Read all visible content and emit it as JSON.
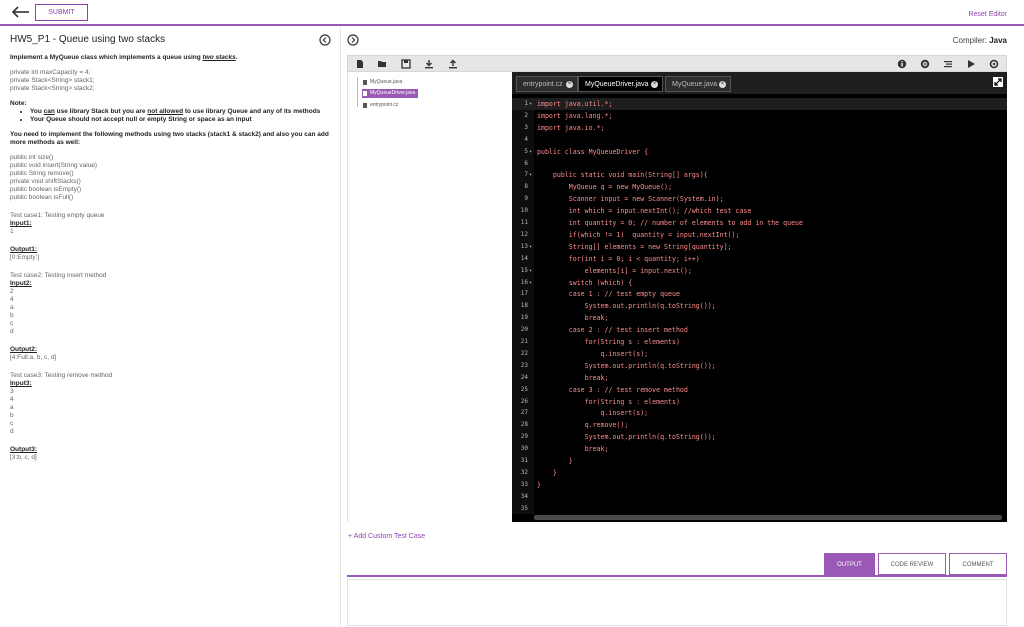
{
  "header": {
    "submit_label": "SUBMIT",
    "reset_label": "Reset Editor"
  },
  "problem": {
    "title": "HW5_P1 - Queue using two stacks",
    "intro_prefix": "Implement a MyQueue class which implements a queue using ",
    "intro_emph": "two stacks",
    "intro_suffix": ".",
    "fields": [
      "private int maxCapacity = 4;",
      "private Stack<String> stack1;",
      "private Stack<String> stack2;"
    ],
    "note_label": "Note:",
    "note1_a": "You ",
    "note1_can": "can",
    "note1_b": " use library Stack but you are ",
    "note1_not": "not allowed",
    "note1_c": " to use library Queue and any of its methods",
    "note2": "Your Queue should not accept null or empty String or space as an input",
    "task": "You need to implement the following methods using two stacks (stack1 & stack2) and also you can add more methods as well:",
    "methods": [
      "public int size()",
      "public void insert(String value)",
      "public String remove()",
      "private void shiftStacks()",
      "public boolean isEmpty()",
      "public boolean isFull()"
    ],
    "cases": [
      {
        "title": "Test case1: Testing empty queue",
        "input_label": "Input1:",
        "input": [
          "1"
        ],
        "output_label": "Output1:",
        "output": "[0:Empty:]"
      },
      {
        "title": "Test case2: Testing insert method",
        "input_label": "Input2:",
        "input": [
          "2",
          "4",
          "a",
          "b",
          "c",
          "d"
        ],
        "output_label": "Output2:",
        "output": "[4:Full:a, b, c, d]"
      },
      {
        "title": "Test case3: Testing remove method",
        "input_label": "Input3:",
        "input": [
          "3",
          "4",
          "a",
          "b",
          "c",
          "d"
        ],
        "output_label": "Output3:",
        "output": "[3:b, c, d]"
      }
    ]
  },
  "compiler": {
    "label": "Compiler:",
    "value": "Java"
  },
  "toolbar_icons": [
    "new-file-icon",
    "open-folder-icon",
    "save-icon",
    "download-icon",
    "upload-icon",
    "info-icon",
    "settings-icon",
    "format-icon",
    "run-icon",
    "debug-icon"
  ],
  "files": [
    "MyQueue.java",
    "MyQueueDriver.java",
    "entrypoint.cz"
  ],
  "active_file": "MyQueueDriver.java",
  "tabs": [
    "entrypoint.cz",
    "MyQueueDriver.java",
    "MyQueue.java"
  ],
  "active_tab": "MyQueueDriver.java",
  "code_lines": [
    "import java.util.*;",
    "import java.lang.*;",
    "import java.io.*;",
    "",
    "public class MyQueueDriver {",
    "",
    "    public static void main(String[] args){",
    "        MyQueue q = new MyQueue();",
    "        Scanner input = new Scanner(System.in);",
    "        int which = input.nextInt(); //which test case",
    "        int quantity = 0; // number of elements to add in the queue",
    "        if(which != 1)  quantity = input.nextInt();",
    "        String[] elements = new String[quantity];",
    "        for(int i = 0; i < quantity; i++)",
    "            elements[i] = input.next();",
    "        switch (which) {",
    "        case 1 : // test empty queue",
    "            System.out.println(q.toString());",
    "            break;",
    "        case 2 : // test insert method",
    "            for(String s : elements)",
    "                q.insert(s);",
    "            System.out.println(q.toString());",
    "            break;",
    "        case 3 : // test remove method",
    "            for(String s : elements)",
    "                q.insert(s);",
    "            q.remove();",
    "            System.out.println(q.toString());",
    "            break;",
    "        }",
    "    }",
    "}",
    "",
    ""
  ],
  "fold_lines": [
    1,
    5,
    7,
    13,
    15,
    16
  ],
  "add_case_label": "+ Add Custom Test Case",
  "output_tabs": [
    "OUTPUT",
    "CODE REVIEW",
    "COMMENT"
  ],
  "active_output_tab": "OUTPUT",
  "colors": {
    "accent": "#9b59b6",
    "code_text": "#ff8c8c",
    "editor_bg": "#000000"
  }
}
